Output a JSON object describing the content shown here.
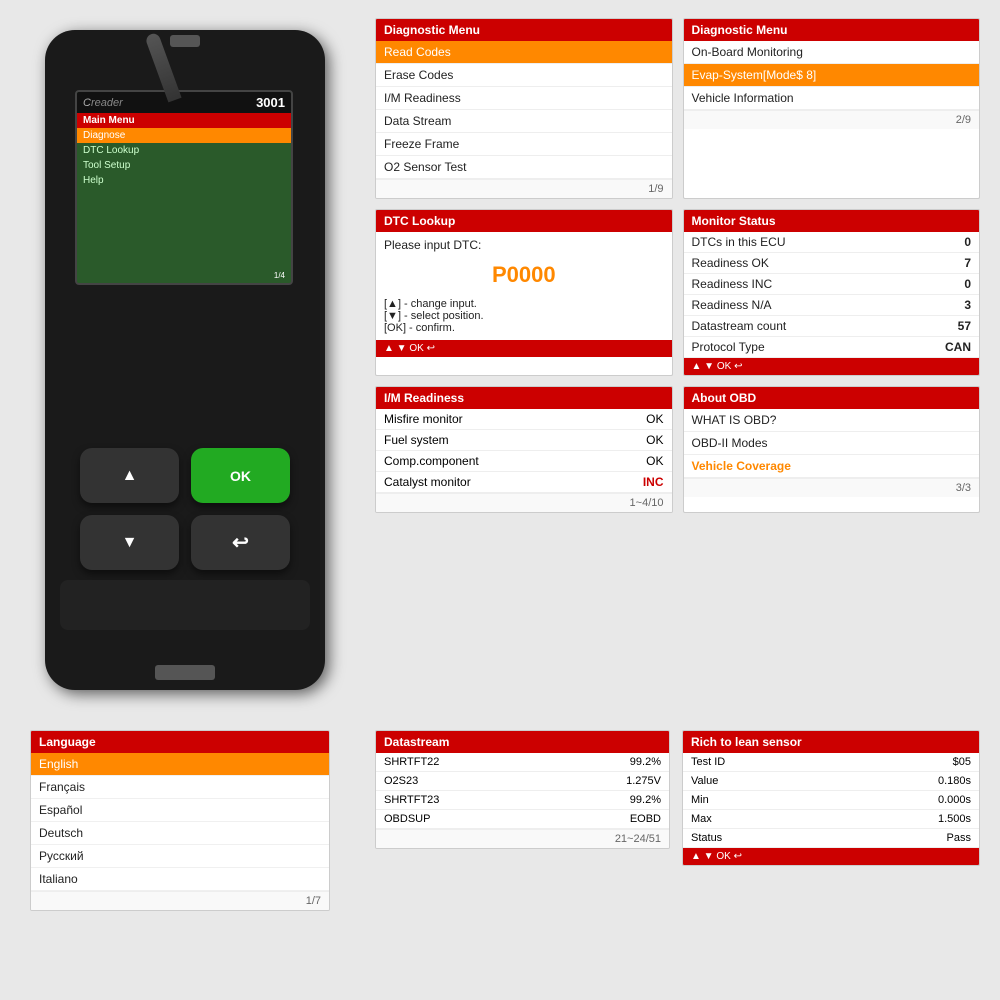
{
  "device": {
    "brand": "Creader",
    "model": "3001",
    "screen": {
      "header": "Main Menu",
      "menu_items": [
        "Diagnose",
        "DTC Lookup",
        "Tool Setup",
        "Help"
      ],
      "selected": "Diagnose",
      "page": "1/4"
    },
    "buttons": {
      "up": "▲",
      "ok": "OK",
      "down": "▼",
      "back": "↩"
    }
  },
  "panels": {
    "diagnostic_menu_1": {
      "header": "Diagnostic Menu",
      "items": [
        "Read Codes",
        "Erase Codes",
        "I/M Readiness",
        "Data Stream",
        "Freeze Frame",
        "O2 Sensor Test"
      ],
      "highlighted": "Read Codes",
      "page": "1/9"
    },
    "diagnostic_menu_2": {
      "header": "Diagnostic Menu",
      "items": [
        "On-Board Monitoring",
        "Evap-System[Mode$ 8]",
        "Vehicle Information"
      ],
      "highlighted": "Evap-System[Mode$ 8]",
      "page": "2/9"
    },
    "dtc_lookup": {
      "header": "DTC Lookup",
      "prompt": "Please input DTC:",
      "code": "P0000",
      "hints": [
        "[▲] - change input.",
        "[▼] - select position.",
        "[OK] - confirm."
      ],
      "footer_controls": "▲ ▼ OK ↩"
    },
    "monitor_status": {
      "header": "Monitor Status",
      "rows": [
        {
          "label": "DTCs in this ECU",
          "value": "0"
        },
        {
          "label": "Readiness OK",
          "value": "7"
        },
        {
          "label": "Readiness INC",
          "value": "0"
        },
        {
          "label": "Readiness N/A",
          "value": "3"
        },
        {
          "label": "Datastream count",
          "value": "57"
        },
        {
          "label": "Protocol Type",
          "value": "CAN"
        }
      ],
      "footer_controls": "▲ ▼ OK ↩"
    },
    "im_readiness": {
      "header": "I/M Readiness",
      "rows": [
        {
          "label": "Misfire monitor",
          "value": "OK"
        },
        {
          "label": "Fuel system",
          "value": "OK"
        },
        {
          "label": "Comp.component",
          "value": "OK"
        },
        {
          "label": "Catalyst monitor",
          "value": "INC"
        }
      ],
      "page": "1~4/10"
    },
    "about_obd": {
      "header": "About OBD",
      "items": [
        "WHAT IS OBD?",
        "OBD-II Modes",
        "Vehicle Coverage"
      ],
      "highlighted": "Vehicle Coverage",
      "page": "3/3"
    },
    "language": {
      "header": "Language",
      "items": [
        "English",
        "Français",
        "Español",
        "Deutsch",
        "Русский",
        "Italiano"
      ],
      "selected": "English",
      "page": "1/7"
    },
    "datastream": {
      "header": "Datastream",
      "rows": [
        {
          "label": "SHRTFT22",
          "value": "99.2%"
        },
        {
          "label": "O2S23",
          "value": "1.275V"
        },
        {
          "label": "SHRTFT23",
          "value": "99.2%"
        },
        {
          "label": "OBDSUP",
          "value": "EOBD"
        }
      ],
      "page": "21~24/51"
    },
    "rich_to_lean": {
      "header": "Rich to lean sensor",
      "rows": [
        {
          "label": "Test ID",
          "value": "$05"
        },
        {
          "label": "Value",
          "value": "0.180s"
        },
        {
          "label": "Min",
          "value": "0.000s"
        },
        {
          "label": "Max",
          "value": "1.500s"
        },
        {
          "label": "Status",
          "value": "Pass"
        }
      ],
      "footer_controls": "▲ ▼ OK ↩"
    }
  },
  "colors": {
    "accent_red": "#cc0000",
    "accent_orange": "#ff8800",
    "accent_green": "#22aa22",
    "text_dark": "#222222",
    "text_light": "#666666"
  }
}
